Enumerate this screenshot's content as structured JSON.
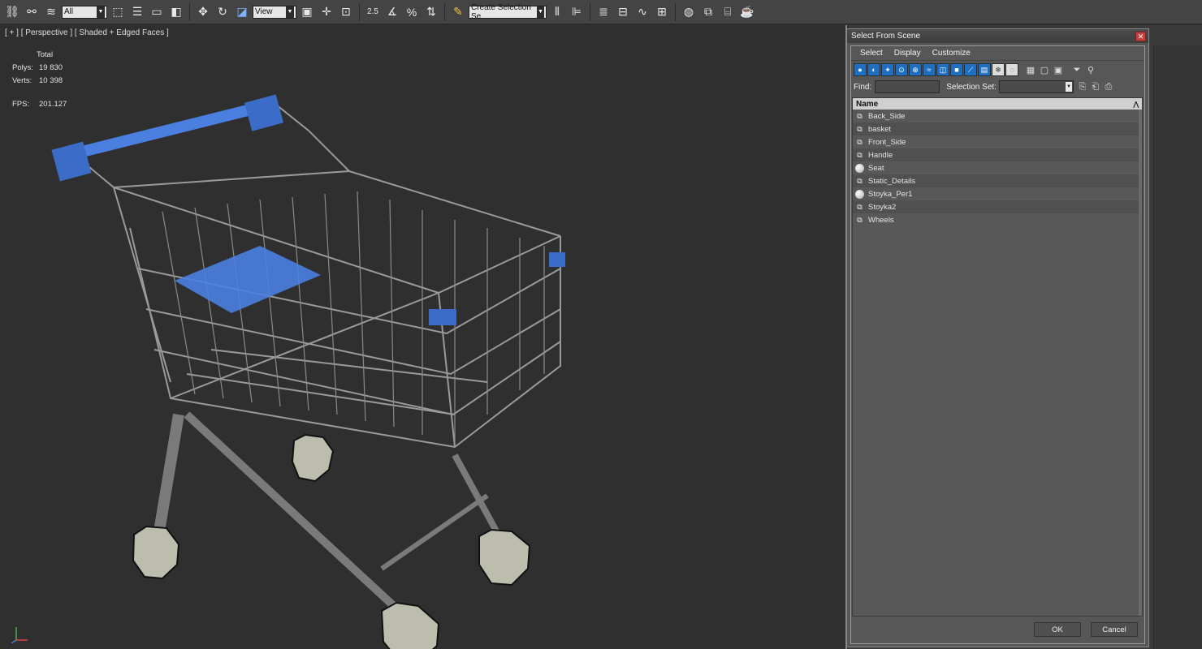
{
  "toolbar": {
    "filter_value": "All",
    "coord_value": "View",
    "selection_set_placeholder": "Create Selection Se",
    "snap_label": "2.5",
    "angle_label": "∡",
    "percent_label": "%"
  },
  "viewport": {
    "label": "[ + ] [ Perspective ] [ Shaded + Edged Faces ]",
    "stats": {
      "header": "Total",
      "polys_label": "Polys:",
      "polys_value": "19 830",
      "verts_label": "Verts:",
      "verts_value": "10 398",
      "fps_label": "FPS:",
      "fps_value": "201.127"
    }
  },
  "dialog": {
    "title": "Select From Scene",
    "menu": [
      "Select",
      "Display",
      "Customize"
    ],
    "find_label": "Find:",
    "selection_set_label": "Selection Set:",
    "column_name": "Name",
    "items": [
      {
        "name": "Back_Side",
        "icon": "mesh-icon"
      },
      {
        "name": "basket",
        "icon": "mesh-icon"
      },
      {
        "name": "Front_Side",
        "icon": "mesh-icon"
      },
      {
        "name": "Handle",
        "icon": "mesh-icon"
      },
      {
        "name": "Seat",
        "icon": "sphere-icon"
      },
      {
        "name": "Static_Details",
        "icon": "mesh-icon"
      },
      {
        "name": "Stoyka_Per1",
        "icon": "sphere-icon"
      },
      {
        "name": "Stoyka2",
        "icon": "mesh-icon"
      },
      {
        "name": "Wheels",
        "icon": "mesh-icon"
      }
    ],
    "ok_label": "OK",
    "cancel_label": "Cancel"
  },
  "colors": {
    "accent_blue": "#1e6fc0",
    "stats_yellow": "#d8d820",
    "model_blue": "#4a7fe0"
  }
}
